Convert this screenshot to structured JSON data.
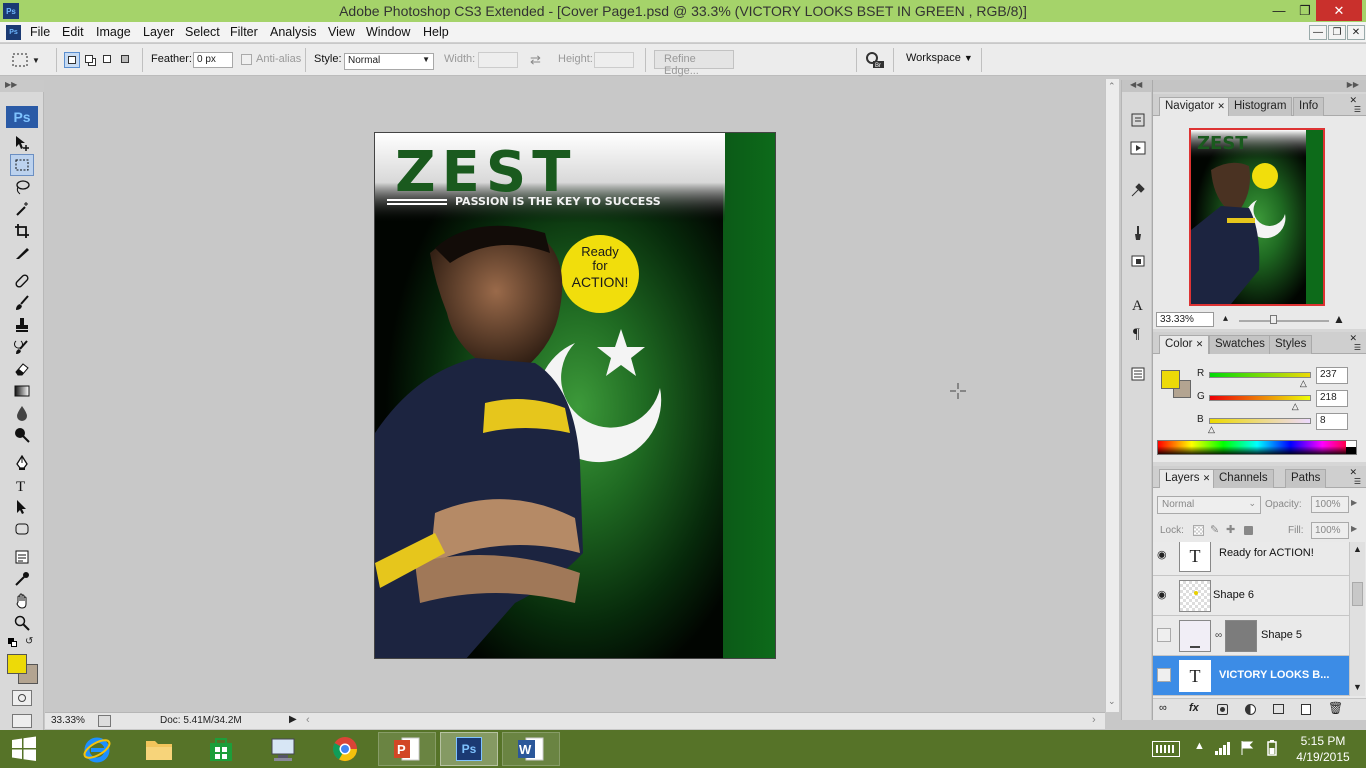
{
  "window": {
    "title": "Adobe Photoshop CS3 Extended - [Cover Page1.psd @ 33.3% (VICTORY LOOKS BSET IN GREEN , RGB/8)]",
    "app_icon": "Ps"
  },
  "menu": [
    "File",
    "Edit",
    "Image",
    "Layer",
    "Select",
    "Filter",
    "Analysis",
    "View",
    "Window",
    "Help"
  ],
  "options": {
    "feather_label": "Feather:",
    "feather_value": "0 px",
    "antialias_label": "Anti-alias",
    "style_label": "Style:",
    "style_value": "Normal",
    "width_label": "Width:",
    "height_label": "Height:",
    "refine_edge": "Refine Edge...",
    "workspace": "Workspace"
  },
  "toolbox": {
    "ps_logo": "Ps"
  },
  "document": {
    "masthead": "ZEST",
    "tagline": "PASSION IS THE KEY TO SUCCESS",
    "badge_line1": "Ready",
    "badge_line2": "for",
    "badge_line3": "ACTION!"
  },
  "status": {
    "zoom": "33.33%",
    "doc": "Doc: 5.41M/34.2M"
  },
  "navigator": {
    "tabs": [
      "Navigator",
      "Histogram",
      "Info"
    ],
    "zoom": "33.33%",
    "thumb_title": "ZEST"
  },
  "color_panel": {
    "tabs": [
      "Color",
      "Swatches",
      "Styles"
    ],
    "r_label": "R",
    "g_label": "G",
    "b_label": "B",
    "r": "237",
    "g": "218",
    "b": "8",
    "fg_color": "#edda08",
    "bg_color": "#b3a491",
    "r_level": 0.93,
    "g_level": 0.85,
    "b_level": 0.03
  },
  "layers_panel": {
    "tabs": [
      "Layers",
      "Channels",
      "Paths"
    ],
    "blend_mode": "Normal",
    "opacity_label": "Opacity:",
    "opacity": "100%",
    "lock_label": "Lock:",
    "fill_label": "Fill:",
    "fill": "100%",
    "layers": [
      {
        "name": "Ready for ACTION!",
        "visible": true
      },
      {
        "name": "Shape 6",
        "visible": true
      },
      {
        "name": "Shape 5",
        "visible": false
      },
      {
        "name": "VICTORY LOOKS B...",
        "visible": false,
        "selected": true
      }
    ]
  },
  "taskbar": {
    "time": "5:15 PM",
    "date": "4/19/2015"
  }
}
